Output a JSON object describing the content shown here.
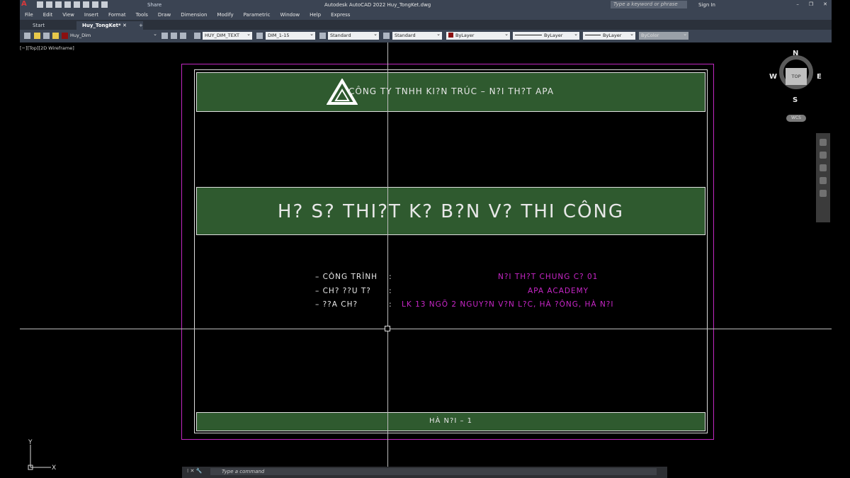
{
  "titlebar": {
    "app_title": "Autodesk AutoCAD 2022   Huy_TongKet.dwg",
    "share_label": "Share",
    "search_placeholder": "Type a keyword or phrase",
    "sign_in_label": "Sign In"
  },
  "menu": [
    "File",
    "Edit",
    "View",
    "Insert",
    "Format",
    "Tools",
    "Draw",
    "Dimension",
    "Modify",
    "Parametric",
    "Window",
    "Help",
    "Express"
  ],
  "tabs": [
    {
      "label": "Start"
    },
    {
      "label": "Huy_TongKet*"
    },
    {
      "label": "+"
    }
  ],
  "properties": {
    "layer": "Huy_Dim",
    "text_style": "HUY_DIM_TEXT",
    "dim_style": "DIM_1-15",
    "table_style": "Standard",
    "multileader_style": "Standard",
    "color": "ByLayer",
    "linetype": "ByLayer",
    "lineweight": "ByLayer",
    "plot_style": "ByColor"
  },
  "viewport_label": "[−][Top][2D Wireframe]",
  "drawing": {
    "company": "CÔNG TY TNHH KI?N TRÚC – N?I TH?T APA",
    "main_title": "H? S? THI?T K? B?N V? THI CÔNG",
    "rows": [
      {
        "label": "– CÔNG TRÌNH",
        "sep": ":",
        "value": "N?I TH?T CHUNG C? 01"
      },
      {
        "label": "– CH? ??U T?",
        "sep": ":",
        "value": "APA ACADEMY"
      },
      {
        "label": "– ??A CH?",
        "sep": ":",
        "value": "LK 13 NGÕ 2 NGUY?N V?N L?C, HÀ ?ÔNG, HÀ N?I"
      }
    ],
    "footer": "HÀ N?I – 1"
  },
  "viewcube": {
    "face": "TOP",
    "n": "N",
    "s": "S",
    "e": "E",
    "w": "W",
    "wcs": "WCS"
  },
  "ucs": {
    "x": "X",
    "y": "Y"
  },
  "command": {
    "placeholder": "Type a command"
  },
  "colors": {
    "green_band": "#2f5a2f",
    "magenta": "#c726c7",
    "frame_magenta": "#c228c2"
  }
}
